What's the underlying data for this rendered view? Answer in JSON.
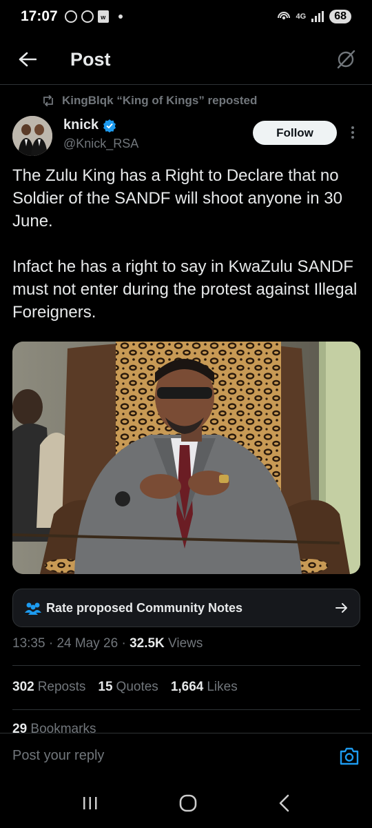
{
  "status_bar": {
    "time": "17:07",
    "network": "4G",
    "battery": "68"
  },
  "header": {
    "title": "Post"
  },
  "repost": {
    "text": "KingBlqk “King of Kings” reposted"
  },
  "author": {
    "name": "knick",
    "handle": "@Knick_RSA",
    "verified": true,
    "follow_label": "Follow"
  },
  "tweet": {
    "paragraphs": [
      "The Zulu King has a Right to Declare that no Soldier of the SANDF will shoot anyone in 30 June.",
      "Infact he has a right to say in KwaZulu SANDF must not enter during the protest against Illegal Foreigners."
    ]
  },
  "community_notes": {
    "label": "Rate proposed Community Notes"
  },
  "meta": {
    "time": "13:35",
    "date": "24 May 26",
    "views_count": "32.5K",
    "views_label": "Views"
  },
  "stats": {
    "reposts_count": "302",
    "reposts_label": "Reposts",
    "quotes_count": "15",
    "quotes_label": "Quotes",
    "likes_count": "1,664",
    "likes_label": "Likes",
    "bookmarks_count": "29",
    "bookmarks_label": "Bookmarks"
  },
  "reply": {
    "placeholder": "Post your reply"
  },
  "colors": {
    "accent": "#1d9bf0",
    "background": "#000000",
    "text_primary": "#e7e9ea",
    "text_secondary": "#71767b",
    "follow_bg": "#eff3f4"
  }
}
